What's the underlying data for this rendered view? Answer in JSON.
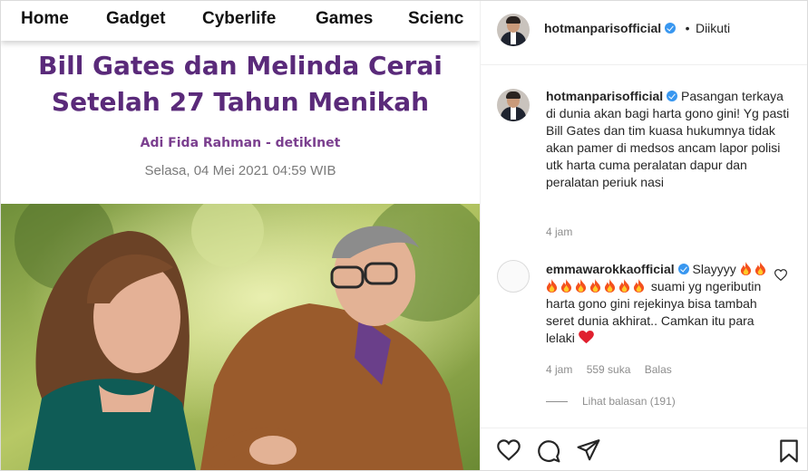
{
  "article": {
    "nav": [
      "Home",
      "Gadget",
      "Cyberlife",
      "Games",
      "Scienc"
    ],
    "headline_line1": "Bill Gates dan Melinda Cerai",
    "headline_line2": "Setelah 27 Tahun Menikah",
    "byline": "Adi Fida Rahman - detikInet",
    "date": "Selasa, 04 Mei 2021 04:59 WIB"
  },
  "header": {
    "username": "hotmanparisofficial",
    "separator": "•",
    "follow_status": "Diikuti"
  },
  "caption": {
    "username": "hotmanparisofficial",
    "text": "Pasangan terkaya di dunia akan bagi harta gono gini! Yg pasti Bill Gates dan tim kuasa hukumnya tidak akan pamer di medsos ancam lapor polisi utk harta cuma peralatan dapur dan peralatan periuk nasi",
    "time": "4 jam"
  },
  "comment": {
    "username": "emmawarokkaofficial",
    "text_start": "Slayyyy",
    "flame_count": 9,
    "text_after_flames": "suami yg ngeributin harta gono gini rejekinya bisa tambah seret dunia akhirat.. Camkan itu para lelaki",
    "time": "4 jam",
    "likes": "559 suka",
    "reply": "Balas",
    "view_replies": "Lihat balasan (191)"
  },
  "icons": {
    "like": "heart-outline-icon",
    "comment": "comment-bubble-icon",
    "share": "paper-plane-icon",
    "save": "bookmark-icon",
    "verified": "verified-badge-icon",
    "flame": "fire-emoji-icon",
    "heart_emoji": "red-heart-emoji-icon"
  },
  "colors": {
    "headline": "#5a2a7a",
    "byline": "#7b3f8f",
    "verified": "#3897f0",
    "meta": "#8e8e8e",
    "text": "#262626"
  }
}
